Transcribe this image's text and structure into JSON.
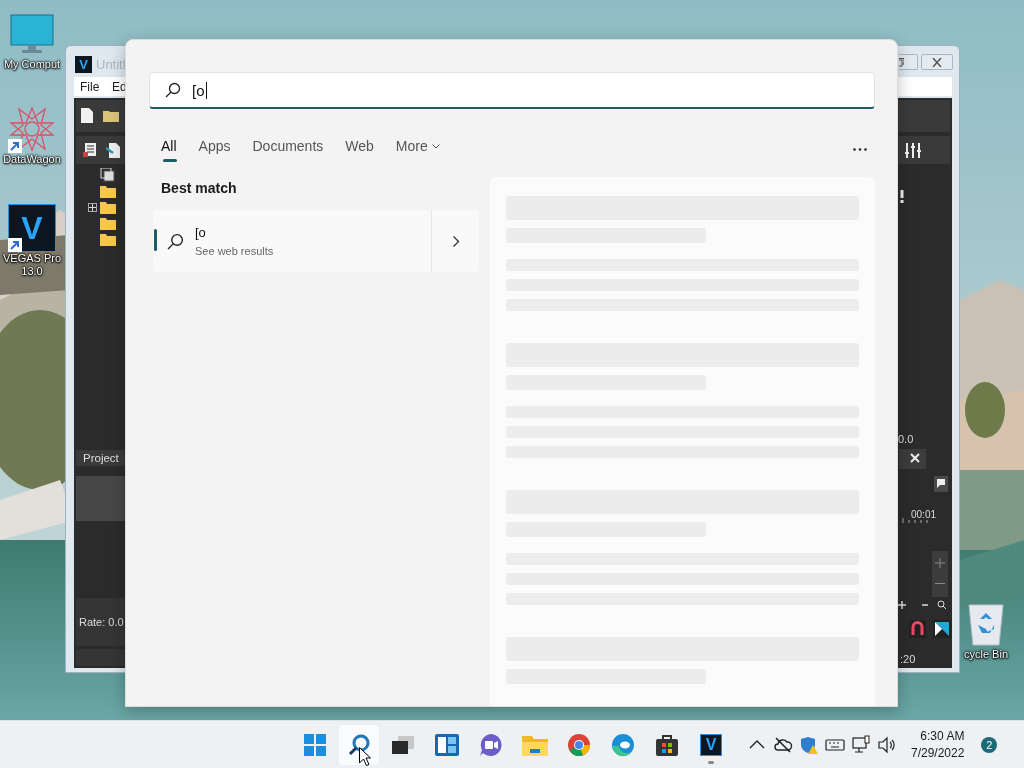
{
  "desktop": {
    "icons": [
      {
        "kind": "computer",
        "label": "My Comput",
        "shortcut": false
      },
      {
        "kind": "datawagon",
        "label": "DataWagon",
        "shortcut": true
      },
      {
        "kind": "vegas",
        "glyph": "V",
        "label": "VEGAS Pro 13.0",
        "shortcut": true
      },
      {
        "kind": "recycle-bin",
        "label": "cycle Bin",
        "shortcut": false
      }
    ]
  },
  "background_window": {
    "app_glyph": "V",
    "title": "Untitl",
    "menu": [
      "File",
      "Ed"
    ],
    "tree_items": [
      {
        "kind": "media",
        "expandable": false
      },
      {
        "kind": "folder",
        "expandable": false
      },
      {
        "kind": "folder",
        "expandable": true
      },
      {
        "kind": "folder",
        "expandable": false
      },
      {
        "kind": "folder",
        "expandable": false
      }
    ],
    "panel_tab": "Project",
    "rate": "Rate: 0.0",
    "meter_reading": "0.0",
    "ruler_time": "00:01",
    "time_readout": ":20"
  },
  "search": {
    "query": "[o",
    "tabs": [
      {
        "label": "All",
        "selected": true,
        "kind": "tab"
      },
      {
        "label": "Apps",
        "selected": false,
        "kind": "tab"
      },
      {
        "label": "Documents",
        "selected": false,
        "kind": "tab"
      },
      {
        "label": "Web",
        "selected": false,
        "kind": "tab"
      },
      {
        "label": "More",
        "selected": false,
        "kind": "dropdown"
      }
    ],
    "best_match_heading": "Best match",
    "best_match": {
      "title": "[o",
      "subtitle": "See web results"
    }
  },
  "taskbar": {
    "apps": [
      {
        "kind": "start",
        "highlighted": false,
        "running": false
      },
      {
        "kind": "search",
        "highlighted": true,
        "running": false
      },
      {
        "kind": "task-view",
        "highlighted": false,
        "running": false
      },
      {
        "kind": "widgets",
        "highlighted": false,
        "running": false
      },
      {
        "kind": "chat",
        "highlighted": false,
        "running": false
      },
      {
        "kind": "file-explorer",
        "highlighted": false,
        "running": false
      },
      {
        "kind": "chrome",
        "highlighted": false,
        "running": false
      },
      {
        "kind": "edge",
        "highlighted": false,
        "running": false
      },
      {
        "kind": "store",
        "highlighted": false,
        "running": false
      },
      {
        "kind": "vegas",
        "glyph": "V",
        "highlighted": false,
        "running": true
      }
    ],
    "tray": [
      {
        "kind": "chevron"
      },
      {
        "kind": "cloud-off"
      },
      {
        "kind": "shield"
      },
      {
        "kind": "keyboard"
      },
      {
        "kind": "network"
      },
      {
        "kind": "volume"
      }
    ],
    "time": "6:30 AM",
    "date": "7/29/2022",
    "notification_count": "2"
  }
}
